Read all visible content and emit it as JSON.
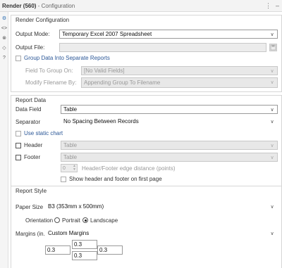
{
  "window": {
    "title": "Render (560)",
    "subtitle": "- Configuration"
  },
  "render_configuration": {
    "section_title": "Render Configuration",
    "output_mode_label": "Output Mode:",
    "output_mode_value": "Temporary Excel 2007 Spreadsheet",
    "output_file_label": "Output File:",
    "output_file_value": "",
    "group_data_label": "Group Data Into Separate Reports",
    "field_to_group_label": "Field To Group On:",
    "field_to_group_value": "[No Valid Fields]",
    "modify_filename_label": "Modify Filename By:",
    "modify_filename_value": "Appending Group To Filename"
  },
  "report_data": {
    "section_title": "Report Data",
    "data_field_label": "Data Field",
    "data_field_value": "Table",
    "separator_label": "Separator",
    "separator_value": "No Spacing Between Records",
    "static_chart_label": "Use static chart",
    "header_label": "Header",
    "header_value": "Table",
    "footer_label": "Footer",
    "footer_value": "Table",
    "distance_value": "0",
    "distance_label": "Header/Footer edge distance (points)",
    "show_first_page_label": "Show header and footer on first page"
  },
  "report_style": {
    "section_title": "Report Style",
    "paper_size_label": "Paper Size",
    "paper_size_value": "B3 (353mm x 500mm)",
    "orientation_label": "Orientation",
    "portrait_label": "Portrait",
    "landscape_label": "Landscape",
    "orientation_selected": "Landscape",
    "margins_label": "Margins (in.)",
    "margins_value": "Custom Margins",
    "margin_top": "0.3",
    "margin_left": "0.3",
    "margin_right": "0.3",
    "margin_bottom": "0.3"
  },
  "colors": {
    "accent": "#2b6cb0",
    "disabled_bg": "#e8e8e8",
    "border": "#9a9a9a"
  }
}
